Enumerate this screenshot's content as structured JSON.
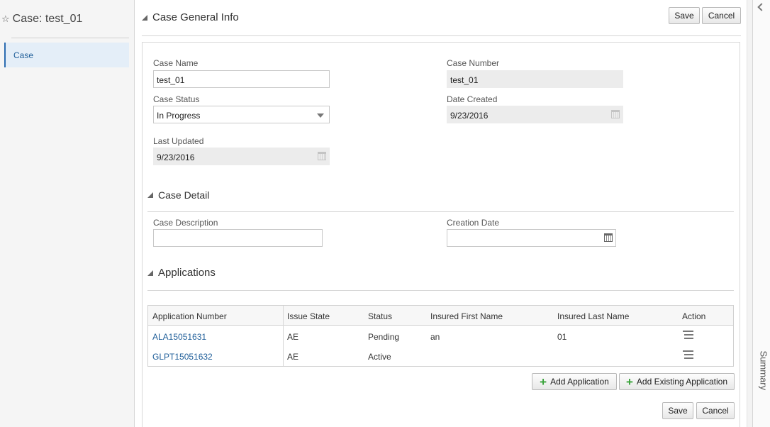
{
  "left_panel": {
    "title": "Case: test_01",
    "nav_items": [
      {
        "label": "Case"
      }
    ]
  },
  "toolbar": {
    "save_label": "Save",
    "cancel_label": "Cancel"
  },
  "general_info": {
    "header": "Case General Info",
    "case_name_label": "Case Name",
    "case_name_value": "test_01",
    "case_number_label": "Case Number",
    "case_number_value": "test_01",
    "case_status_label": "Case Status",
    "case_status_value": "In Progress",
    "date_created_label": "Date Created",
    "date_created_value": "9/23/2016",
    "last_updated_label": "Last Updated",
    "last_updated_value": "9/23/2016"
  },
  "case_detail": {
    "header": "Case Detail",
    "description_label": "Case Description",
    "description_value": "",
    "creation_date_label": "Creation Date",
    "creation_date_value": ""
  },
  "applications": {
    "header": "Applications",
    "columns": [
      "Application Number",
      "Issue State",
      "Status",
      "Insured First Name",
      "Insured Last Name",
      "Action"
    ],
    "rows": [
      {
        "number": "ALA15051631",
        "issue_state": "AE",
        "status": "Pending",
        "first_name": "an",
        "last_name": "01",
        "action_icon": "menu-lines-icon"
      },
      {
        "number": "GLPT15051632",
        "issue_state": "AE",
        "status": "Active",
        "first_name": "",
        "last_name": "",
        "action_icon": "menu-lines-icon"
      }
    ],
    "add_application_label": "Add Application",
    "add_existing_label": "Add Existing Application"
  },
  "footer": {
    "save_label": "Save",
    "cancel_label": "Cancel"
  },
  "right_panel": {
    "label": "Summary",
    "collapse_icon": "chevron-left-icon"
  },
  "colors": {
    "accent": "#1f5e99",
    "plus": "#39a33a",
    "nav_bg": "#e4eef8"
  }
}
